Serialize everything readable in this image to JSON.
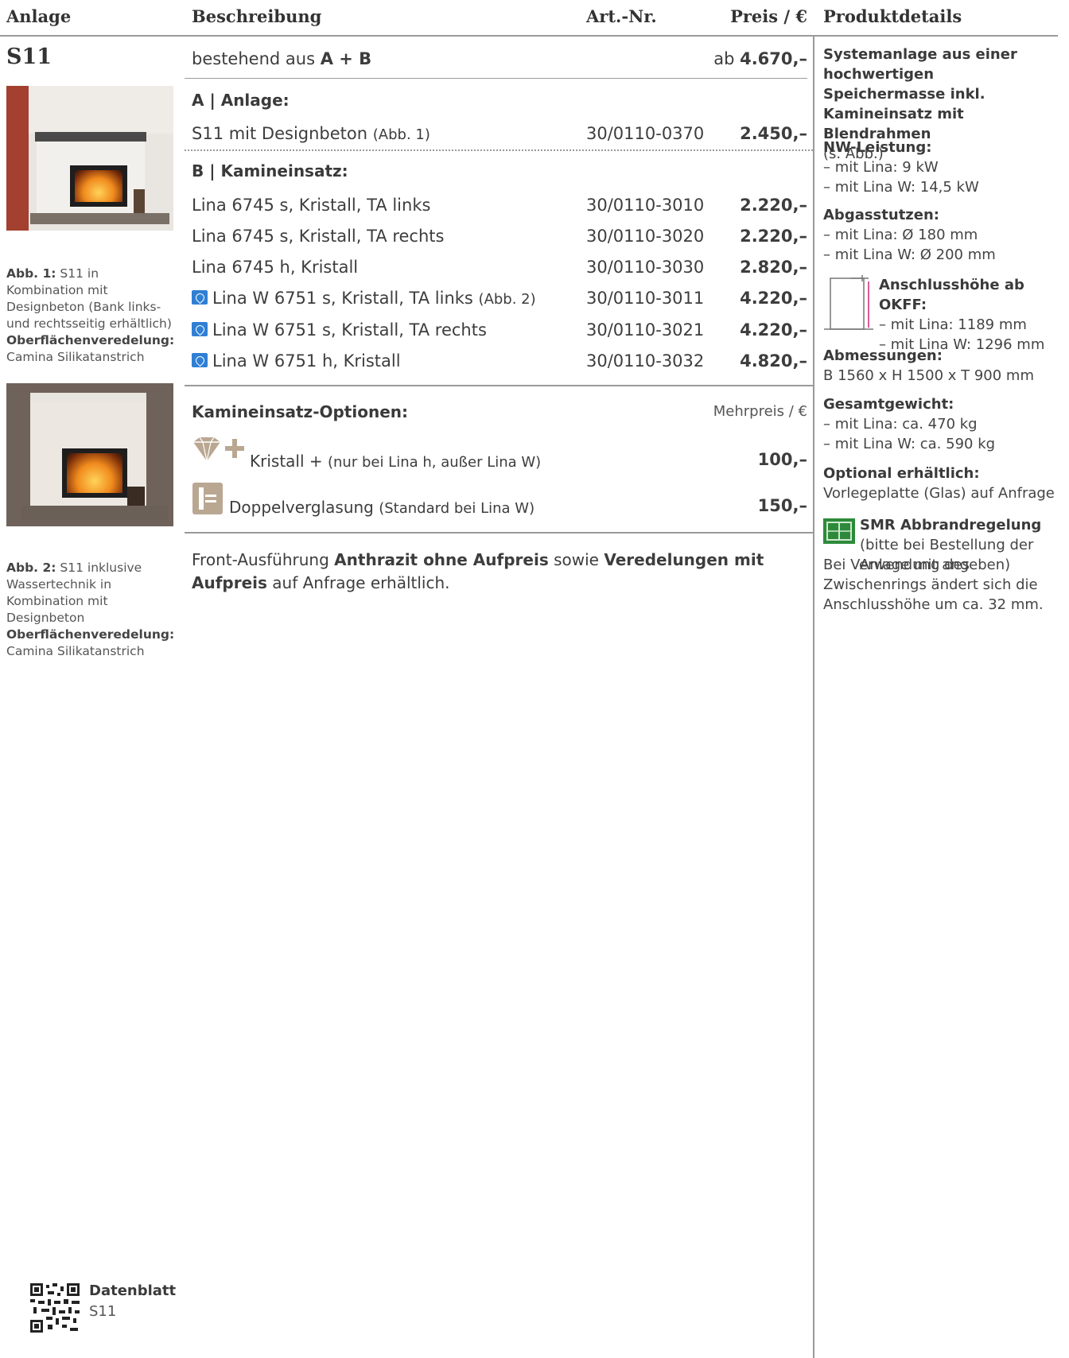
{
  "headers": {
    "anlage": "Anlage",
    "beschreibung": "Beschreibung",
    "artnr": "Art.-Nr.",
    "preis": "Preis / €",
    "produktdetails": "Produktdetails"
  },
  "product": {
    "code": "S11",
    "composition_prefix": "bestehend aus",
    "composition_bold": "A + B",
    "price_prefix": "ab",
    "price": "4.670,–"
  },
  "section_a": {
    "title": "A | Anlage:",
    "rows": [
      {
        "desc": "S11 mit Designbeton",
        "note": "(Abb. 1)",
        "art": "30/0110-0370",
        "price": "2.450,–"
      }
    ]
  },
  "section_b": {
    "title": "B | Kamineinsatz:",
    "rows": [
      {
        "desc": "Lina 6745 s, Kristall, TA links",
        "art": "30/0110-3010",
        "price": "2.220,–"
      },
      {
        "desc": "Lina 6745 s, Kristall, TA rechts",
        "art": "30/0110-3020",
        "price": "2.220,–"
      },
      {
        "desc": "Lina 6745 h, Kristall",
        "art": "30/0110-3030",
        "price": "2.820,–"
      },
      {
        "desc": "Lina W 6751 s, Kristall, TA links",
        "note": "(Abb. 2)",
        "art": "30/0110-3011",
        "price": "4.220,–",
        "icon": "water-technology-icon"
      },
      {
        "desc": "Lina W 6751 s, Kristall, TA rechts",
        "art": "30/0110-3021",
        "price": "4.220,–",
        "icon": "water-technology-icon"
      },
      {
        "desc": "Lina W 6751 h, Kristall",
        "art": "30/0110-3032",
        "price": "4.820,–",
        "icon": "water-technology-icon"
      }
    ]
  },
  "options": {
    "title": "Kamineinsatz-Optionen:",
    "price_label": "Mehrpreis / €",
    "items": [
      {
        "label": "Kristall +",
        "note": "(nur bei Lina h, außer Lina W)",
        "price": "100,–",
        "icon": "diamond-plus-icon"
      },
      {
        "label": "Doppelverglasung",
        "note": "(Standard bei Lina W)",
        "price": "150,–",
        "icon": "double-glazing-icon"
      }
    ]
  },
  "footnote": {
    "t1": "Front-Ausführung",
    "b1": "Anthrazit ohne Aufpreis",
    "t2": "sowie",
    "b2": "Veredelungen mit Aufpreis",
    "t3": "auf Anfrage erhältlich."
  },
  "captions": [
    {
      "label": "Abb. 1:",
      "text": "S11 in Kombination mit Designbeton (Bank links-und rechtsseitig erhältlich)",
      "surface_label": "Oberflächenveredelung:",
      "surface": "Camina Silikatanstrich"
    },
    {
      "label": "Abb. 2:",
      "text": "S11 inklusive Wassertechnik in Kombination mit Designbeton",
      "surface_label": "Oberflächenveredelung:",
      "surface": "Camina Silikatanstrich"
    }
  ],
  "details": {
    "intro_bold": "Systemanlage aus einer hochwertigen Speichermasse inkl. Kamineinsatz mit Blendrahmen",
    "intro_note": "(s. Abb.)",
    "nw_title": "NW-Leistung:",
    "nw": [
      "– mit Lina: 9 kW",
      "– mit Lina W: 14,5 kW"
    ],
    "abgas_title": "Abgasstutzen:",
    "abgas": [
      "– mit Lina: Ø 180 mm",
      "– mit Lina W: Ø 200 mm"
    ],
    "anschluss_title": "Anschlusshöhe ab OKFF:",
    "anschluss": [
      "– mit Lina: 1189 mm",
      "– mit Lina W: 1296 mm"
    ],
    "abm_title": "Abmessungen:",
    "abm": "B 1560 x H 1500 x T 900 mm",
    "gewicht_title": "Gesamtgewicht:",
    "gewicht": [
      "– mit Lina: ca. 470 kg",
      "– mit Lina W: ca. 590 kg"
    ],
    "optional_title": "Optional erhältlich:",
    "optional": "Vorlegeplatte (Glas) auf Anfrage",
    "smr_title": "SMR Abbrandregelung",
    "smr_note": "(bitte bei Bestellung der Anlage mit angeben)",
    "smr_text": "Bei Verwendung des Zwischenrings ändert sich die Anschlusshöhe um ca. 32 mm."
  },
  "datasheet": {
    "title": "Datenblatt",
    "code": "S11"
  }
}
